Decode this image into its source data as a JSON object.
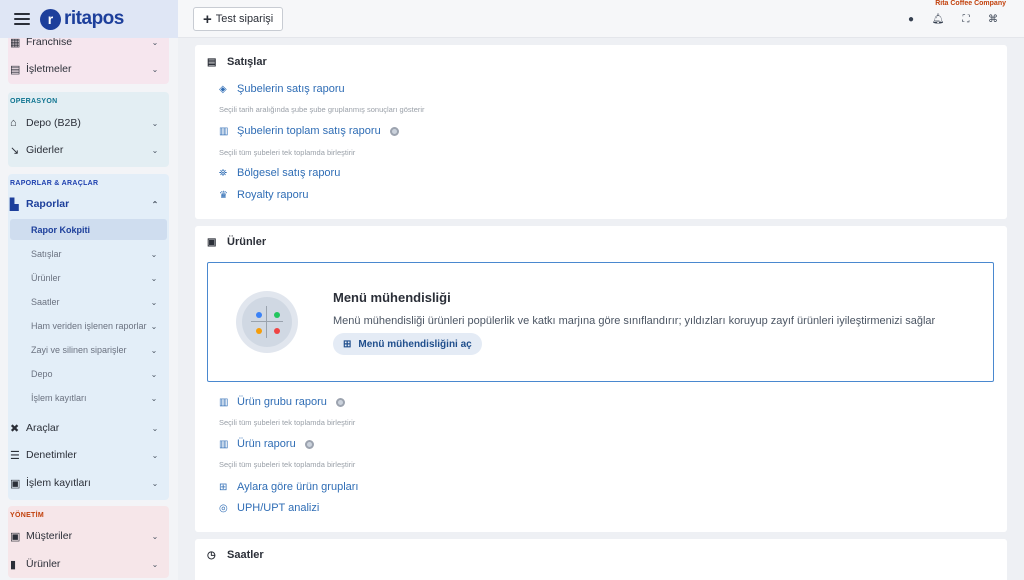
{
  "header": {
    "logo_mark": "r",
    "logo_text": "ritapos",
    "test_order_label": "Test siparişi",
    "company": "Rita Coffee Company"
  },
  "sidebar": {
    "top_items": [
      {
        "label": "Franchise",
        "icon": "franchise-icon"
      },
      {
        "label": "İşletmeler",
        "icon": "store-icon"
      }
    ],
    "operations": {
      "title": "OPERASYON",
      "items": [
        {
          "label": "Depo (B2B)",
          "icon": "warehouse-icon"
        },
        {
          "label": "Giderler",
          "icon": "trend-down-icon"
        }
      ]
    },
    "reports": {
      "title": "RAPORLAR & ARAÇLAR",
      "main": {
        "label": "Raporlar",
        "icon": "chart-icon"
      },
      "active": "Rapor Kokpiti",
      "subs": [
        "Satışlar",
        "Ürünler",
        "Saatler",
        "Ham veriden işlenen raporlar",
        "Zayi ve silinen siparişler",
        "Depo",
        "İşlem kayıtları"
      ],
      "items": [
        {
          "label": "Araçlar",
          "icon": "tools-icon"
        },
        {
          "label": "Denetimler",
          "icon": "checklist-icon"
        },
        {
          "label": "İşlem kayıtları",
          "icon": "clipboard-icon"
        }
      ]
    },
    "management": {
      "title": "YÖNETİM",
      "items": [
        {
          "label": "Müşteriler",
          "icon": "contact-icon"
        },
        {
          "label": "Ürünler",
          "icon": "product-icon"
        }
      ]
    }
  },
  "sales": {
    "title": "Satışlar",
    "branch_report": "Şubelerin satış raporu",
    "branch_report_desc": "Seçili tarih aralığında şube şube gruplanmış sonuçları gösterir",
    "total_report": "Şubelerin toplam satış raporu",
    "total_report_desc": "Seçili tüm şubeleri tek toplamda birleştirir",
    "regional_report": "Bölgesel satış raporu",
    "royalty_report": "Royalty raporu"
  },
  "products": {
    "title": "Ürünler",
    "feature_title": "Menü mühendisliği",
    "feature_desc": "Menü mühendisliği ürünleri popülerlik ve katkı marjına göre sınıflandırır; yıldızları koruyup zayıf ürünleri iyileştirmenizi sağlar",
    "feature_button": "Menü mühendisliğini aç",
    "group_report": "Ürün grubu raporu",
    "group_report_desc": "Seçili tüm şubeleri tek toplamda birleştirir",
    "product_report": "Ürün raporu",
    "product_report_desc": "Seçili tüm şubeleri tek toplamda birleştirir",
    "monthly_groups": "Aylara göre ürün grupları",
    "uph_upt": "UPH/UPT analizi"
  },
  "hours": {
    "title": "Saatler"
  }
}
